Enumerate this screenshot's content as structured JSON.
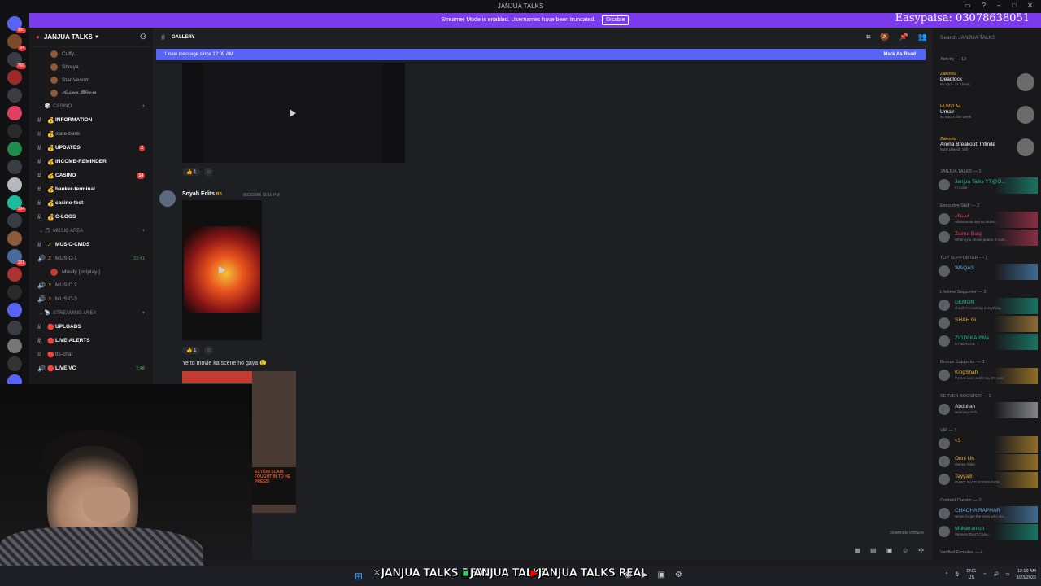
{
  "window": {
    "title": "JANJUA TALKS"
  },
  "banner": {
    "text": "Streamer Mode is enabled. Usernames have been truncated.",
    "disable_label": "Disable",
    "overlay_text": "Easypaisa: 03078638051"
  },
  "guilds": {
    "badges": [
      "990",
      "24",
      "760",
      "",
      "",
      "",
      "",
      "",
      "",
      "",
      "194",
      "",
      "",
      "161",
      "",
      "",
      "",
      "",
      "",
      "",
      "",
      ""
    ]
  },
  "server": {
    "name": "JANJUA TALKS"
  },
  "sidebar": {
    "top_users": [
      "Cuffy...",
      "Shreya",
      "Star Venom",
      "𝓐𝓼𝓲𝓶𝓪 𝓑𝓵𝓸𝓸𝓶"
    ],
    "categories": {
      "casino": "CASINO",
      "music": "MUSIC AREA",
      "streaming": "STREAMING AREA"
    },
    "casino_channels": [
      {
        "name": "INFORMATION",
        "badge": ""
      },
      {
        "name": "state-bank",
        "badge": ""
      },
      {
        "name": "UPDATES",
        "badge": "2"
      },
      {
        "name": "INCOME-REMINDER",
        "badge": ""
      },
      {
        "name": "CASINO",
        "badge": "14"
      },
      {
        "name": "banker-terminal",
        "badge": ""
      },
      {
        "name": "casino-test",
        "badge": ""
      },
      {
        "name": "C-LOGS",
        "badge": ""
      }
    ],
    "music_channels": [
      {
        "name": "MUSIC-CMDS"
      },
      {
        "name": "MUSIC-1",
        "time": "23:41"
      },
      {
        "name": "MUSIC 2"
      },
      {
        "name": "MUSIC-3"
      }
    ],
    "music_user": "Musify [ m!play ]",
    "streaming_channels": [
      {
        "name": "UPLOADS"
      },
      {
        "name": "LIVE-ALERTS"
      },
      {
        "name": "tts-chat"
      },
      {
        "name": "LIVE VC",
        "time": "7:46"
      }
    ]
  },
  "channel": {
    "name": "GALLERY"
  },
  "new_message": {
    "text": "1 new message since 12:09 AM",
    "mark_read": "Mark As Read"
  },
  "messages": {
    "reaction1": "1",
    "author": "Soyab Edits",
    "author_tag": "BS",
    "timestamp": "8/23/2026 11:16 PM",
    "reaction2": "1",
    "caption": "Ye to movie ka scene ho gaya 😢",
    "thumb_text": "ECTION SCAM: FOUGHT IN TO HE PRESS!"
  },
  "footer": {
    "slowmode": "Slowmode immune"
  },
  "members_panel": {
    "search_placeholder": "Search JANJUA TALKS",
    "activity_header": "Activity — 13",
    "activities": [
      {
        "user": "Zakoota",
        "title": "Deadlock",
        "sub": "6h ago · 4x Streak"
      },
      {
        "user": "HUMZI Aa",
        "title": "Umair",
        "sub": "8s tracks this week"
      },
      {
        "user": "Zakoota",
        "title": "Arena Breakout: Infinite",
        "sub": "Most played: 15h"
      }
    ],
    "sections": [
      {
        "title": "JANJUA TALKS — 1",
        "members": [
          {
            "name": "Janjua Talks YT@O...",
            "status": "In voice",
            "color": "#1abc9c"
          }
        ]
      },
      {
        "title": "Executive Staff — 2",
        "members": [
          {
            "name": "𝓝𝓲𝓼𝓪𝓵",
            "status": "Allahumma inni as'aluka...",
            "color": "#e04060"
          },
          {
            "name": "Zaima Baig",
            "status": "When you chose peace, it com...",
            "color": "#e04060"
          }
        ]
      },
      {
        "title": "TOP SUPPORTER — 1",
        "members": [
          {
            "name": "WAQAS",
            "status": "",
            "color": "#5dadec"
          }
        ]
      },
      {
        "title": "Lifetime Supporter — 3",
        "members": [
          {
            "name": "DEMON",
            "status": "shush I'm looking everything",
            "color": "#1abc9c"
          },
          {
            "name": "SHAH Gi",
            "status": "",
            "color": "#e8b04a"
          },
          {
            "name": "ZIDDI KARWA",
            "status": "CYBERCAB",
            "color": "#1abc9c"
          }
        ]
      },
      {
        "title": "Bronze Supporter — 1",
        "members": [
          {
            "name": "KingShah",
            "status": "It's not over until I say it's over",
            "color": "#f0b232"
          }
        ]
      },
      {
        "title": "SERVER BOOSTER — 1",
        "members": [
          {
            "name": "Abdullah",
            "status": "lamimeycatch",
            "color": "#dbdee1"
          }
        ]
      },
      {
        "title": "VIP — 3",
        "members": [
          {
            "name": "<3",
            "status": "",
            "color": "#f0b232"
          },
          {
            "name": "Onni Uh",
            "status": "Money Wala",
            "color": "#f0b232"
          },
          {
            "name": "TayyaB",
            "status": "PUBG: BATTLEGROUNDS",
            "color": "#f0b232"
          }
        ]
      },
      {
        "title": "Content Creator — 2",
        "members": [
          {
            "name": "CHACHA RAPHAR",
            "status": "Never forget the ones who sto...",
            "color": "#5dadec"
          },
          {
            "name": "Mukarramco",
            "status": "Winners Don't Close...",
            "color": "#1abc9c"
          }
        ]
      },
      {
        "title": "Verified Females — 4",
        "members": []
      }
    ]
  },
  "taskbar": {
    "tags": [
      "JANJUA TALKS REAL",
      "JANJUA TALKS",
      "JANJUA TALKS REAL"
    ],
    "lang": "ENG",
    "region": "US",
    "time": "12:10 AM",
    "date": "8/23/2026"
  }
}
